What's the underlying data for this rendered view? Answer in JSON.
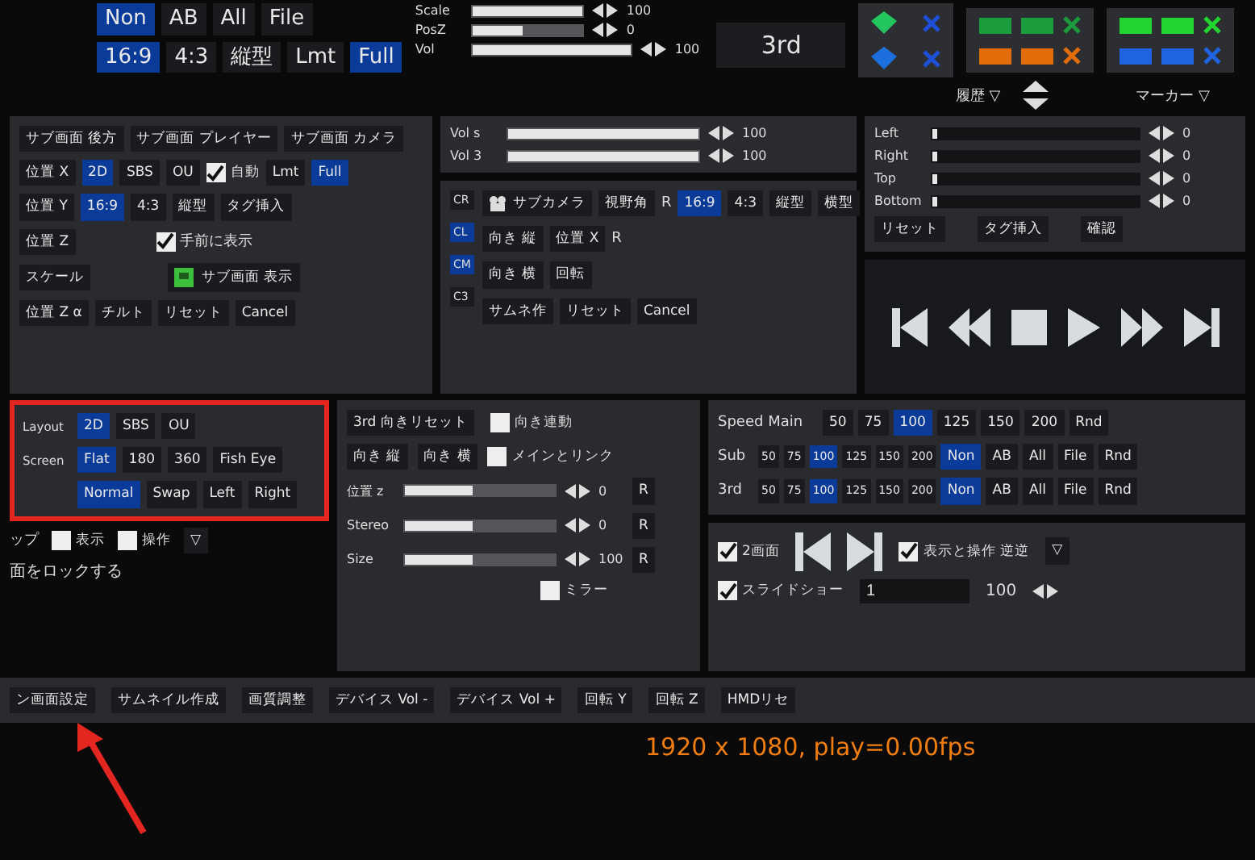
{
  "top": {
    "mode_buttons": [
      {
        "label": "Non",
        "selected": true
      },
      {
        "label": "AB",
        "selected": false
      },
      {
        "label": "All",
        "selected": false
      },
      {
        "label": "File",
        "selected": false
      }
    ],
    "aspect_buttons": [
      {
        "label": "16:9",
        "selected": true
      },
      {
        "label": "4:3",
        "selected": false
      },
      {
        "label": "縦型",
        "selected": false
      },
      {
        "label": "Lmt",
        "selected": false
      },
      {
        "label": "Full",
        "selected": true
      }
    ],
    "sliders": [
      {
        "label": "Scale",
        "level": 1,
        "reading": "100"
      },
      {
        "label": "PosZ",
        "level": 0.45,
        "reading": "0"
      }
    ],
    "vol": {
      "label": "Vol",
      "level": 1,
      "reading": "100"
    },
    "display": "3rd",
    "gems": [
      {
        "color": "#22c55e"
      },
      {
        "color": "#1d6fe0"
      }
    ],
    "swatch_groups": [
      {
        "rows": [
          {
            "color": "#1a9b3c"
          },
          {
            "color": "#e26b0a"
          }
        ]
      },
      {
        "rows": [
          {
            "color": "#22d42f"
          },
          {
            "color": "#1f63e0"
          }
        ]
      }
    ],
    "history": "履歴 ▽",
    "marker": "マーカー ▽"
  },
  "sub_panel": {
    "tabs": [
      "サブ画面 後方",
      "サブ画面 プレイヤー",
      "サブ画面 カメラ"
    ],
    "position_buttons": [
      "位置 X",
      "位置 Y",
      "位置 Z",
      "スケール",
      "位置 Z α"
    ],
    "tilt": "チルト",
    "layout_options": [
      {
        "label": "2D",
        "selected": true
      },
      {
        "label": "SBS",
        "selected": false
      },
      {
        "label": "OU",
        "selected": false
      }
    ],
    "aspect_options": [
      {
        "label": "16:9",
        "selected": true
      },
      {
        "label": "4:3",
        "selected": false
      },
      {
        "label": "縦型",
        "selected": false
      }
    ],
    "auto": {
      "label": "自動",
      "checked": true
    },
    "fit_options": [
      {
        "label": "Lmt",
        "selected": false
      },
      {
        "label": "Full",
        "selected": true
      }
    ],
    "tag": "タグ挿入",
    "front": {
      "label": "手前に表示",
      "checked": true
    },
    "show": "サブ画面 表示",
    "reset": "リセット",
    "cancel": "Cancel"
  },
  "volumes": [
    {
      "label": "Vol s",
      "level": 1,
      "reading": "100"
    },
    {
      "label": "Vol 3",
      "level": 1,
      "reading": "100"
    }
  ],
  "camera_panel": {
    "chips": [
      {
        "label": "CR",
        "selected": false
      },
      {
        "label": "CL",
        "selected": true
      },
      {
        "label": "CM",
        "selected": true
      },
      {
        "label": "C3",
        "selected": false
      }
    ],
    "camera": "サブカメラ",
    "fov": "視野角",
    "fov_r": "R",
    "aspect_options": [
      {
        "label": "16:9",
        "selected": true
      },
      {
        "label": "4:3",
        "selected": false
      },
      {
        "label": "縦型",
        "selected": false
      },
      {
        "label": "横型",
        "selected": false
      }
    ],
    "dir_v": "向き 縦",
    "pos_x": "位置 X",
    "pos_x_r": "R",
    "dir_h": "向き 横",
    "rotate": "回転",
    "thumb": "サムネ作",
    "reset": "リセット",
    "cancel": "Cancel"
  },
  "crop_panel": {
    "sliders": [
      {
        "label": "Left",
        "level": 0,
        "reading": "0"
      },
      {
        "label": "Right",
        "level": 0,
        "reading": "0"
      },
      {
        "label": "Top",
        "level": 0,
        "reading": "0"
      },
      {
        "label": "Bottom",
        "level": 0,
        "reading": "0"
      }
    ],
    "buttons": [
      "リセット",
      "タグ挿入",
      "確認"
    ]
  },
  "transport": [
    {
      "kind": "first"
    },
    {
      "kind": "rewind"
    },
    {
      "kind": "stop"
    },
    {
      "kind": "play"
    },
    {
      "kind": "forward"
    },
    {
      "kind": "last"
    }
  ],
  "layout_panel": {
    "highlighted": true,
    "rows": [
      {
        "label": "Layout",
        "options": [
          {
            "label": "2D",
            "selected": true
          },
          {
            "label": "SBS",
            "selected": false
          },
          {
            "label": "OU",
            "selected": false
          }
        ]
      },
      {
        "label": "Screen",
        "options": [
          {
            "label": "Flat",
            "selected": true
          },
          {
            "label": "180",
            "selected": false
          },
          {
            "label": "360",
            "selected": false
          },
          {
            "label": "Fish Eye",
            "selected": false
          }
        ]
      },
      {
        "label": "",
        "options": [
          {
            "label": "Normal",
            "selected": true
          },
          {
            "label": "Swap",
            "selected": false
          },
          {
            "label": "Left",
            "selected": false
          },
          {
            "label": "Right",
            "selected": false
          }
        ]
      }
    ],
    "cut_label": "ップ",
    "show": {
      "label": "表示",
      "checked": false
    },
    "operate": {
      "label": "操作",
      "checked": false
    },
    "menu": "▽",
    "lock": "面をロックする"
  },
  "third_panel": {
    "reset": "3rd 向きリセット",
    "link_dir": {
      "label": "向き連動",
      "checked": false
    },
    "dir_v": "向き 縦",
    "dir_h": "向き 横",
    "link_main": {
      "label": "メインとリンク",
      "checked": false
    },
    "sliders": [
      {
        "label": "位置 z",
        "level": 0.45,
        "reading": "0",
        "reset": "R"
      },
      {
        "label": "Stereo",
        "level": 0.45,
        "reading": "0",
        "reset": "R"
      },
      {
        "label": "Size",
        "level": 0.45,
        "reading": "100",
        "reset": "R"
      }
    ],
    "mirror": {
      "label": "ミラー",
      "checked": false
    }
  },
  "speed_panel": {
    "rows": [
      {
        "label": "Speed Main",
        "kind": "main",
        "speeds": [
          {
            "label": "50",
            "selected": false
          },
          {
            "label": "75",
            "selected": false
          },
          {
            "label": "100",
            "selected": true
          },
          {
            "label": "125",
            "selected": false
          },
          {
            "label": "150",
            "selected": false
          },
          {
            "label": "200",
            "selected": false
          }
        ],
        "random": "Rnd"
      },
      {
        "label": "Sub",
        "kind": "small",
        "speeds": [
          {
            "label": "50",
            "selected": false
          },
          {
            "label": "75",
            "selected": false
          },
          {
            "label": "100",
            "selected": true
          },
          {
            "label": "125",
            "selected": false
          },
          {
            "label": "150",
            "selected": false
          },
          {
            "label": "200",
            "selected": false
          }
        ],
        "modes": [
          {
            "label": "Non",
            "selected": true
          },
          {
            "label": "AB",
            "selected": false
          },
          {
            "label": "All",
            "selected": false
          },
          {
            "label": "File",
            "selected": false
          }
        ],
        "random": "Rnd"
      },
      {
        "label": "3rd",
        "kind": "small",
        "speeds": [
          {
            "label": "50",
            "selected": false
          },
          {
            "label": "75",
            "selected": false
          },
          {
            "label": "100",
            "selected": true
          },
          {
            "label": "125",
            "selected": false
          },
          {
            "label": "150",
            "selected": false
          },
          {
            "label": "200",
            "selected": false
          }
        ],
        "modes": [
          {
            "label": "Non",
            "selected": true
          },
          {
            "label": "AB",
            "selected": false
          },
          {
            "label": "All",
            "selected": false
          },
          {
            "label": "File",
            "selected": false
          }
        ],
        "random": "Rnd"
      }
    ]
  },
  "slideshow_panel": {
    "dual": {
      "label": "2画面",
      "checked": true
    },
    "slideshow": {
      "label": "スライドショー",
      "checked": true
    },
    "interval": "1",
    "swap": {
      "label": "表示と操作 逆逆",
      "checked": true
    },
    "reading": "100",
    "menu": "▽"
  },
  "bottom_buttons": [
    "ン画面設定",
    "サムネイル作成",
    "画質調整",
    "デバイス Vol -",
    "デバイス Vol +",
    "回転 Y",
    "回転 Z",
    "HMDリセ"
  ],
  "status": "1920 x 1080,  play=0.00fps"
}
